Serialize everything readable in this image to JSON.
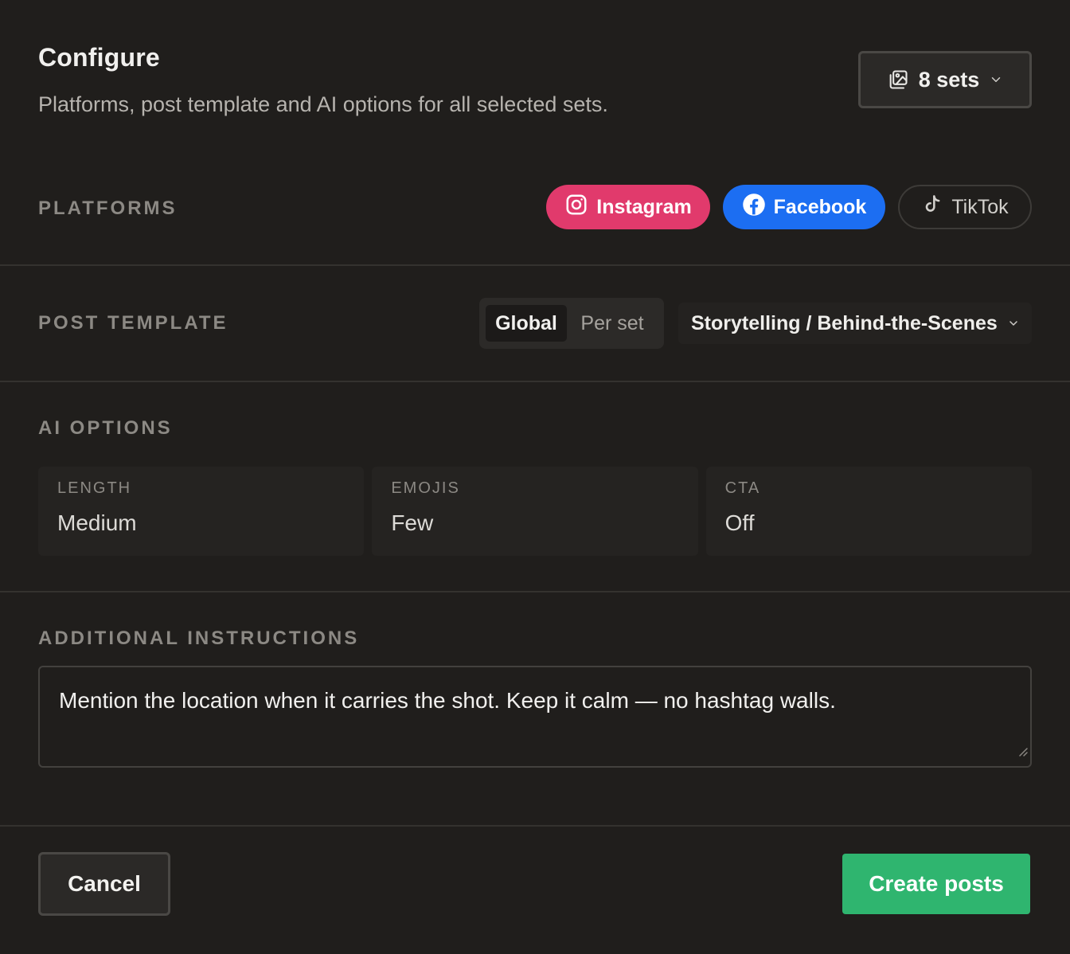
{
  "header": {
    "title": "Configure",
    "subtitle": "Platforms, post template and AI options for all selected sets.",
    "sets_label": "8 sets"
  },
  "platforms": {
    "label": "PLATFORMS",
    "items": [
      {
        "name": "Instagram",
        "selected": true,
        "color": "#e13a6c",
        "icon": "instagram-icon"
      },
      {
        "name": "Facebook",
        "selected": true,
        "color": "#1c6ef2",
        "icon": "facebook-icon"
      },
      {
        "name": "TikTok",
        "selected": false,
        "icon": "tiktok-icon"
      }
    ]
  },
  "post_template": {
    "label": "POST TEMPLATE",
    "scope_options": [
      "Global",
      "Per set"
    ],
    "scope_selected": "Global",
    "selected_template": "Storytelling / Behind-the-Scenes"
  },
  "ai_options": {
    "label": "AI OPTIONS",
    "cards": [
      {
        "key": "LENGTH",
        "value": "Medium"
      },
      {
        "key": "EMOJIS",
        "value": "Few"
      },
      {
        "key": "CTA",
        "value": "Off"
      }
    ]
  },
  "additional_instructions": {
    "label": "ADDITIONAL INSTRUCTIONS",
    "value": "Mention the location when it carries the shot. Keep it calm — no hashtag walls."
  },
  "footer": {
    "cancel_label": "Cancel",
    "create_label": "Create posts",
    "create_color": "#2fb56f"
  }
}
